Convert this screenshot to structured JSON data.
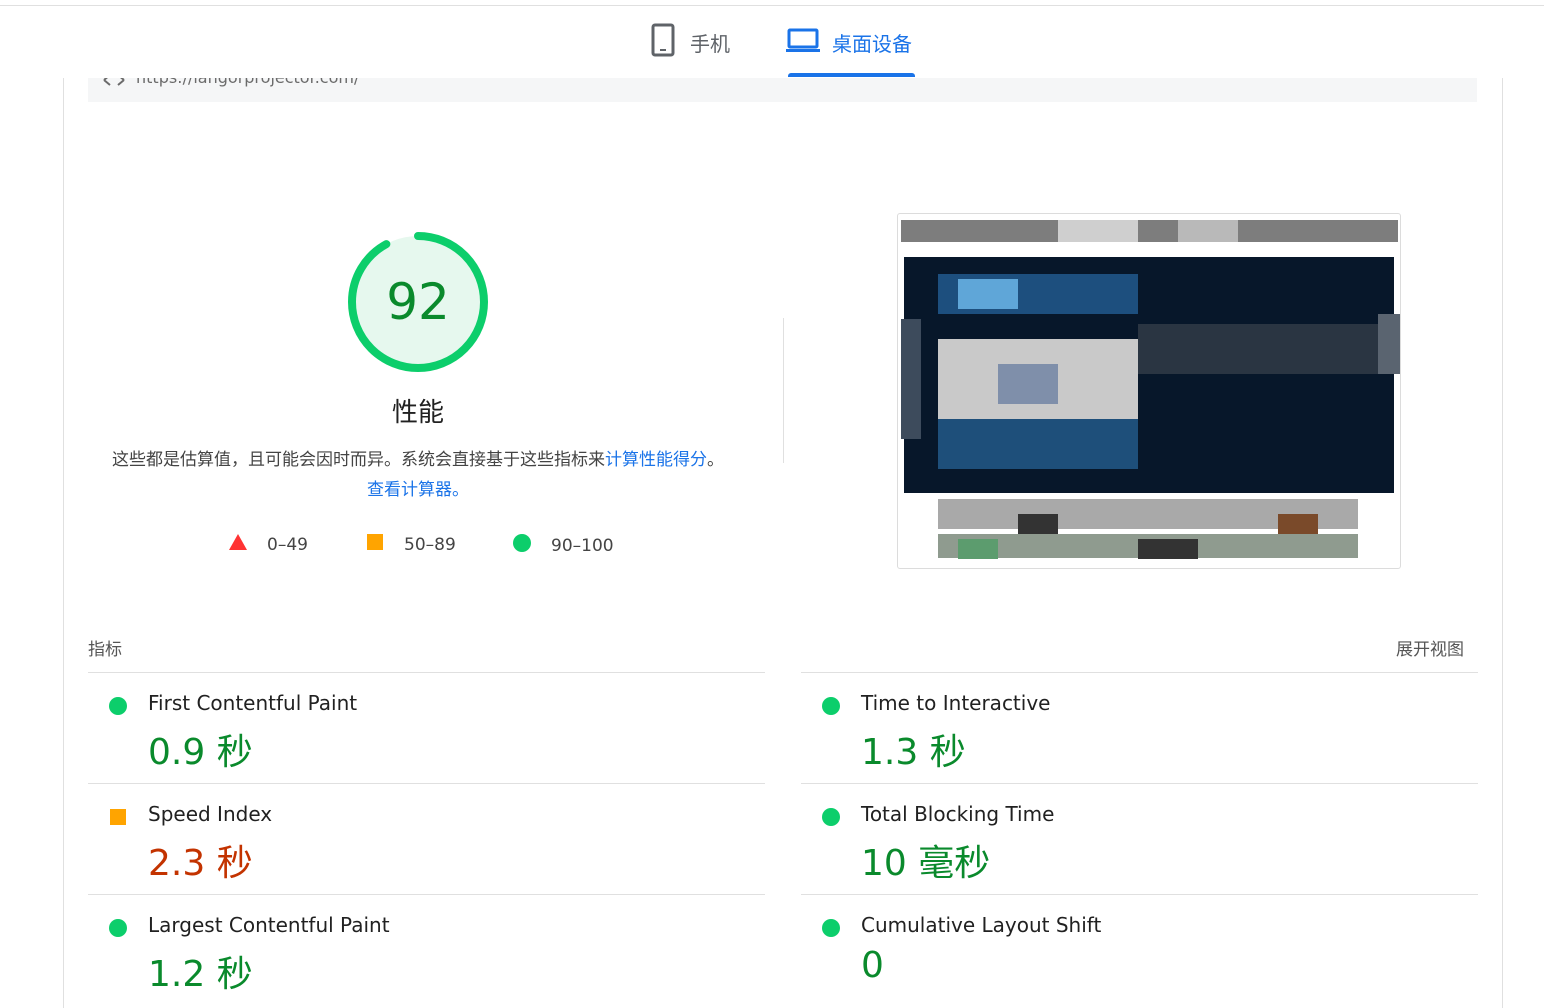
{
  "tabs": {
    "mobile": {
      "label": "手机",
      "icon": "phone-icon",
      "active": false
    },
    "desktop": {
      "label": "桌面设备",
      "icon": "laptop-icon",
      "active": true
    }
  },
  "url": "https://langorprojector.com/",
  "gauge": {
    "score": "92",
    "score_value": 92,
    "title": "性能",
    "color": "#0cce6b"
  },
  "description": {
    "text": "这些都是估算值，且可能会因时而异。系统会直接基于这些指标来",
    "link1": "计算性能得分",
    "sep": "。",
    "link2": "查看计算器。"
  },
  "legend": {
    "fail": {
      "range": "0–49",
      "icon": "triangle-icon",
      "color": "#ff3333"
    },
    "average": {
      "range": "50–89",
      "icon": "square-icon",
      "color": "#ffa400"
    },
    "pass": {
      "range": "90–100",
      "icon": "circle-icon",
      "color": "#0cce6b"
    }
  },
  "metrics_header": {
    "title": "指标",
    "expand": "展开视图"
  },
  "metrics": [
    {
      "name": "First Contentful Paint",
      "value": "0.9 秒",
      "status": "pass"
    },
    {
      "name": "Time to Interactive",
      "value": "1.3 秒",
      "status": "pass"
    },
    {
      "name": "Speed Index",
      "value": "2.3 秒",
      "status": "average"
    },
    {
      "name": "Total Blocking Time",
      "value": "10 毫秒",
      "status": "pass"
    },
    {
      "name": "Largest Contentful Paint",
      "value": "1.2 秒",
      "status": "pass"
    },
    {
      "name": "Cumulative Layout Shift",
      "value": "0",
      "status": "pass"
    }
  ],
  "colors": {
    "accent": "#1a73e8",
    "pass_text": "#0a8a2c",
    "average_text": "#c33300"
  }
}
